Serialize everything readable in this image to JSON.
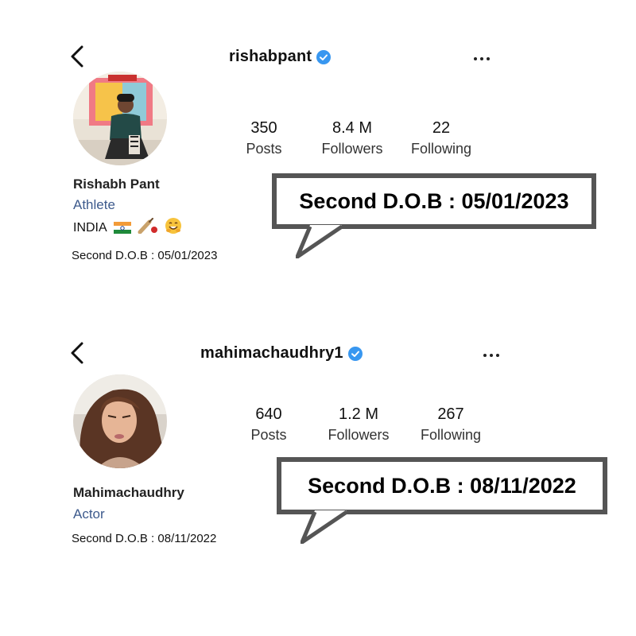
{
  "profiles": [
    {
      "username": "rishabpant",
      "stats": [
        {
          "value": "350",
          "label": "Posts"
        },
        {
          "value": "8.4 M",
          "label": "Followers"
        },
        {
          "value": "22",
          "label": "Following"
        }
      ],
      "name": "Rishabh Pant",
      "category": "Athlete",
      "bio": "INDIA",
      "bio_icons": [
        "india-flag-icon",
        "cricket-bat-ball-icon",
        "smiling-face-icon"
      ],
      "dob_line": "Second D.O.B : 05/01/2023",
      "callout": "Second D.O.B : 05/01/2023"
    },
    {
      "username": "mahimachaudhry1",
      "stats": [
        {
          "value": "640",
          "label": "Posts"
        },
        {
          "value": "1.2 M",
          "label": "Followers"
        },
        {
          "value": "267",
          "label": "Following"
        }
      ],
      "name": "Mahimachaudhry",
      "category": "Actor",
      "dob_line": "Second D.O.B : 08/11/2022",
      "callout": "Second D.O.B : 08/11/2022"
    }
  ],
  "colors": {
    "verified": "#3897f0",
    "category": "#3d5a8c",
    "callout_border": "#555555"
  }
}
